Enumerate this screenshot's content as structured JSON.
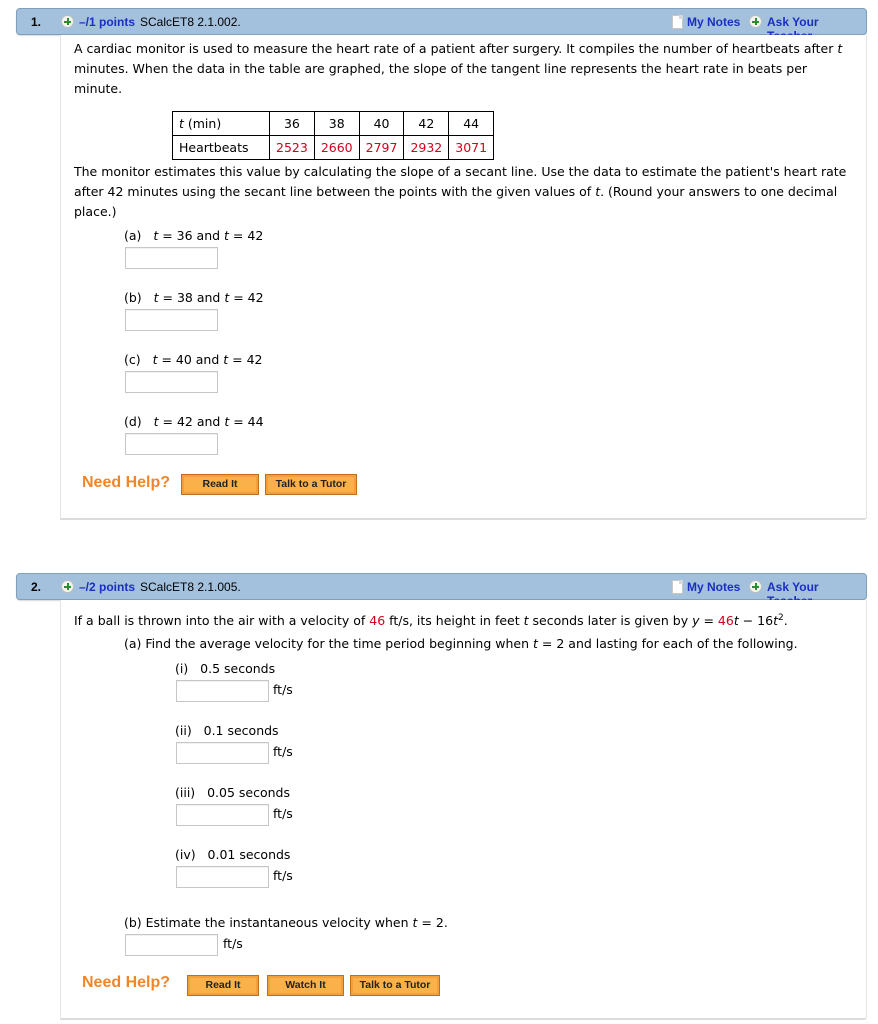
{
  "questions": [
    {
      "number": "1.",
      "points": "–/1 points",
      "code": "SCalcET8 2.1.002.",
      "my_notes": "My Notes",
      "ask_teacher": "Ask Your Teacher",
      "intro_line1": "A cardiac monitor is used to measure the heart rate of a patient after surgery. It compiles the number of heartbeats after",
      "intro_t": "t",
      "intro_line2": "minutes. When the data in the table are graphed, the slope of the tangent line represents the heart rate in beats per",
      "intro_line3": "minute.",
      "table": {
        "row1_label_var": "t",
        "row1_label_unit": " (min)",
        "row2_label": "Heartbeats",
        "t_values": [
          "36",
          "38",
          "40",
          "42",
          "44"
        ],
        "heartbeats": [
          "2523",
          "2660",
          "2797",
          "2932",
          "3071"
        ]
      },
      "instr_line1": "The monitor estimates this value by calculating the slope of a secant line. Use the data to estimate the patient's heart rate",
      "instr_line2a": "after 42 minutes using the secant line between the points with the given values of",
      "instr_line2_t": "t",
      "instr_line2b": ". (Round your answers to one decimal",
      "instr_line3": "place.)",
      "parts": [
        {
          "label": "(a)",
          "t1": "36",
          "t2": "42",
          "value": ""
        },
        {
          "label": "(b)",
          "t1": "38",
          "t2": "42",
          "value": ""
        },
        {
          "label": "(c)",
          "t1": "40",
          "t2": "42",
          "value": ""
        },
        {
          "label": "(d)",
          "t1": "42",
          "t2": "44",
          "value": ""
        }
      ],
      "need_help": "Need Help?",
      "help_buttons": [
        "Read It",
        "Talk to a Tutor"
      ]
    },
    {
      "number": "2.",
      "points": "–/2 points",
      "code": "SCalcET8 2.1.005.",
      "my_notes": "My Notes",
      "ask_teacher": "Ask Your Teacher",
      "stmt_a": "If a ball is thrown into the air with a velocity of",
      "velocity": "46",
      "stmt_b": "ft/s, its height in feet",
      "stmt_t": "t",
      "stmt_c": "seconds later is given by",
      "eq_y": "y",
      "eq_eq": " = ",
      "eq_coef": "46",
      "eq_t": "t",
      "eq_rest": " − 16",
      "eq_t2": "t",
      "eq_exp": "2",
      "eq_end": ".",
      "part_a_text_a": "(a) Find the average velocity for the time period beginning when",
      "part_a_t": "t",
      "part_a_text_b": "= 2 and lasting for each of the following.",
      "subparts": [
        {
          "label": "(i)",
          "duration": "0.5 seconds",
          "value": "",
          "unit": "ft/s"
        },
        {
          "label": "(ii)",
          "duration": "0.1 seconds",
          "value": "",
          "unit": "ft/s"
        },
        {
          "label": "(iii)",
          "duration": "0.05 seconds",
          "value": "",
          "unit": "ft/s"
        },
        {
          "label": "(iv)",
          "duration": "0.01 seconds",
          "value": "",
          "unit": "ft/s"
        }
      ],
      "part_b_text_a": "(b) Estimate the instantaneous velocity when",
      "part_b_t": "t",
      "part_b_text_b": "= 2.",
      "part_b_value": "",
      "part_b_unit": "ft/s",
      "need_help": "Need Help?",
      "help_buttons": [
        "Read It",
        "Watch It",
        "Talk to a Tutor"
      ]
    }
  ]
}
